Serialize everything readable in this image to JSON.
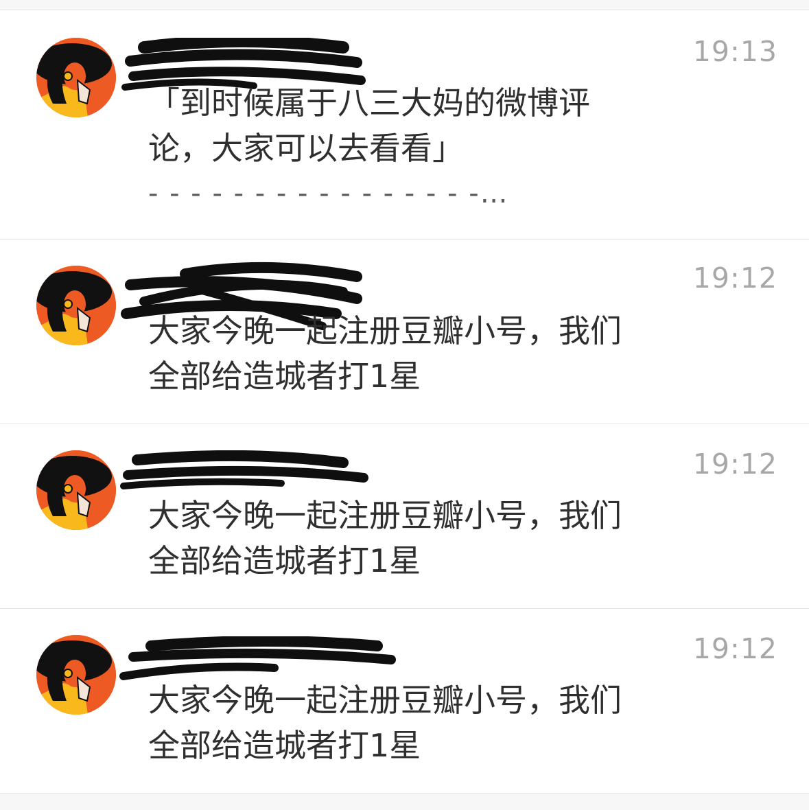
{
  "colors": {
    "background": "#f7f7f7",
    "card": "#ffffff",
    "divider": "#e6e6e6",
    "time": "#a7a7a7",
    "text": "#2f2f2f",
    "avatar_orange": "#ee5a24",
    "avatar_yellow": "#f9b91c",
    "redaction": "#0f0f0f"
  },
  "icons": {
    "avatar": "avatar-woman-wide-brim-hat"
  },
  "messages": [
    {
      "sender": "",
      "time": "19:13",
      "lines": [
        "「到时候属于八三大妈的微博评",
        "论，大家可以去看看」",
        "- - - - - - - - - - - - - - - -…"
      ]
    },
    {
      "sender": "",
      "time": "19:12",
      "lines": [
        "大家今晚一起注册豆瓣小号，我们",
        "全部给造城者打1星"
      ]
    },
    {
      "sender": "",
      "time": "19:12",
      "lines": [
        "大家今晚一起注册豆瓣小号，我们",
        "全部给造城者打1星"
      ]
    },
    {
      "sender": "",
      "time": "19:12",
      "lines": [
        "大家今晚一起注册豆瓣小号，我们",
        "全部给造城者打1星"
      ]
    }
  ]
}
